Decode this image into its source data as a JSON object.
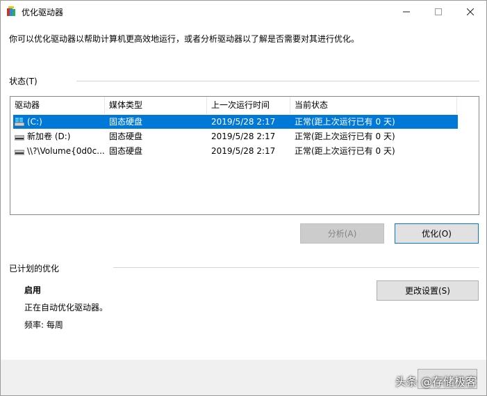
{
  "window": {
    "title": "优化驱动器",
    "description": "你可以优化驱动器以帮助计算机更高效地运行，或者分析驱动器以了解是否需要对其进行优化。"
  },
  "status": {
    "heading": "状态(T)",
    "columns": [
      "驱动器",
      "媒体类型",
      "上一次运行时间",
      "当前状态"
    ],
    "rows": [
      {
        "drive": "(C:)",
        "media": "固态硬盘",
        "last_run": "2019/5/28 2:17",
        "state": "正常(距上次运行已有 0 天)",
        "icon": "windows-drive-icon",
        "selected": true
      },
      {
        "drive": "新加卷 (D:)",
        "media": "固态硬盘",
        "last_run": "2019/5/28 2:17",
        "state": "正常(距上次运行已有 0 天)",
        "icon": "drive-icon",
        "selected": false
      },
      {
        "drive": "\\\\?\\Volume{0d0c...",
        "media": "固态硬盘",
        "last_run": "2019/5/28 2:17",
        "state": "正常(距上次运行已有 0 天)",
        "icon": "drive-icon",
        "selected": false
      }
    ],
    "analyze_label": "分析(A)",
    "optimize_label": "优化(O)"
  },
  "schedule": {
    "heading": "已计划的优化",
    "state": "启用",
    "detail": "正在自动优化驱动器。",
    "frequency": "频率: 每周",
    "change_label": "更改设置(S)"
  },
  "footer": {
    "watermark": "头条 @存储极客"
  },
  "colors": {
    "selection": "#0078d7",
    "button_face": "#e1e1e1",
    "footer_bg": "#f0f0f0"
  }
}
